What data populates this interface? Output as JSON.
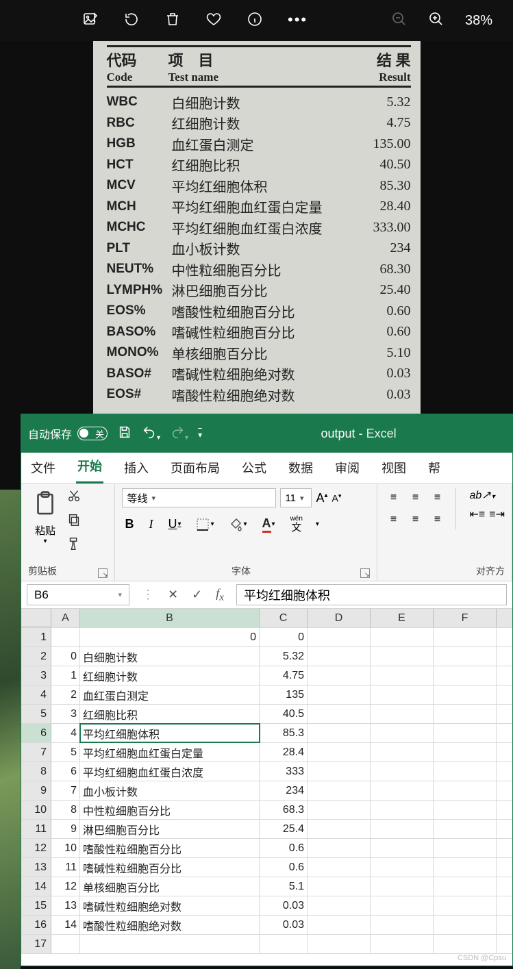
{
  "viewer": {
    "zoom": "38%"
  },
  "paper": {
    "head": {
      "c1_cn": "代码",
      "c1_en": "Code",
      "c2_cn": "项　目",
      "c2_en": "Test name",
      "c3_cn": "结 果",
      "c3_en": "Result"
    },
    "rows": [
      {
        "code": "WBC",
        "name": "白细胞计数",
        "val": "5.32"
      },
      {
        "code": "RBC",
        "name": "红细胞计数",
        "val": "4.75"
      },
      {
        "code": "HGB",
        "name": "血红蛋白测定",
        "val": "135.00"
      },
      {
        "code": "HCT",
        "name": "红细胞比积",
        "val": "40.50"
      },
      {
        "code": "MCV",
        "name": "平均红细胞体积",
        "val": "85.30"
      },
      {
        "code": "MCH",
        "name": "平均红细胞血红蛋白定量",
        "val": "28.40"
      },
      {
        "code": "MCHC",
        "name": "平均红细胞血红蛋白浓度",
        "val": "333.00"
      },
      {
        "code": "PLT",
        "name": "血小板计数",
        "val": "234"
      },
      {
        "code": "NEUT%",
        "name": "中性粒细胞百分比",
        "val": "68.30"
      },
      {
        "code": "LYMPH%",
        "name": "淋巴细胞百分比",
        "val": "25.40"
      },
      {
        "code": "EOS%",
        "name": "嗜酸性粒细胞百分比",
        "val": "0.60"
      },
      {
        "code": "BASO%",
        "name": "嗜碱性粒细胞百分比",
        "val": "0.60"
      },
      {
        "code": "MONO%",
        "name": "单核细胞百分比",
        "val": "5.10"
      },
      {
        "code": "BASO#",
        "name": "嗜碱性粒细胞绝对数",
        "val": "0.03"
      },
      {
        "code": "EOS#",
        "name": "嗜酸性粒细胞绝对数",
        "val": "0.03"
      }
    ]
  },
  "excel": {
    "autosave_label": "自动保存",
    "autosave_off": "关",
    "title_file": "output",
    "title_sep": "  -  ",
    "title_app": "Excel",
    "tabs": [
      "文件",
      "开始",
      "插入",
      "页面布局",
      "公式",
      "数据",
      "审阅",
      "视图",
      "帮"
    ],
    "active_tab": 1,
    "ribbon": {
      "clipboard": {
        "paste": "粘贴",
        "group": "剪贴板"
      },
      "font": {
        "name": "等线",
        "size": "11",
        "group": "字体",
        "wen": "wén",
        "wen2": "文"
      },
      "align": {
        "group": "对齐方"
      }
    },
    "namebox": "B6",
    "formula": "平均红细胞体积",
    "columns": [
      "A",
      "B",
      "C",
      "D",
      "E",
      "F"
    ],
    "rows": [
      {
        "n": "1",
        "a": "",
        "b": "0",
        "b_align": "r",
        "c": "0"
      },
      {
        "n": "2",
        "a": "0",
        "b": "白细胞计数",
        "c": "5.32"
      },
      {
        "n": "3",
        "a": "1",
        "b": "红细胞计数",
        "c": "4.75"
      },
      {
        "n": "4",
        "a": "2",
        "b": "血红蛋白测定",
        "c": "135"
      },
      {
        "n": "5",
        "a": "3",
        "b": "红细胞比积",
        "c": "40.5"
      },
      {
        "n": "6",
        "a": "4",
        "b": "平均红细胞体积",
        "c": "85.3",
        "sel": true
      },
      {
        "n": "7",
        "a": "5",
        "b": "平均红细胞血红蛋白定量",
        "c": "28.4"
      },
      {
        "n": "8",
        "a": "6",
        "b": "平均红细胞血红蛋白浓度",
        "c": "333"
      },
      {
        "n": "9",
        "a": "7",
        "b": "血小板计数",
        "c": "234"
      },
      {
        "n": "10",
        "a": "8",
        "b": "中性粒细胞百分比",
        "c": "68.3"
      },
      {
        "n": "11",
        "a": "9",
        "b": "淋巴细胞百分比",
        "c": "25.4"
      },
      {
        "n": "12",
        "a": "10",
        "b": "嗜酸性粒细胞百分比",
        "c": "0.6"
      },
      {
        "n": "13",
        "a": "11",
        "b": "嗜碱性粒细胞百分比",
        "c": "0.6"
      },
      {
        "n": "14",
        "a": "12",
        "b": "单核细胞百分比",
        "c": "5.1"
      },
      {
        "n": "15",
        "a": "13",
        "b": "嗜碱性粒细胞绝对数",
        "c": "0.03"
      },
      {
        "n": "16",
        "a": "14",
        "b": "嗜酸性粒细胞绝对数",
        "c": "0.03"
      },
      {
        "n": "17",
        "a": "",
        "b": "",
        "c": ""
      }
    ]
  },
  "watermark": "CSDN @Cpsu"
}
